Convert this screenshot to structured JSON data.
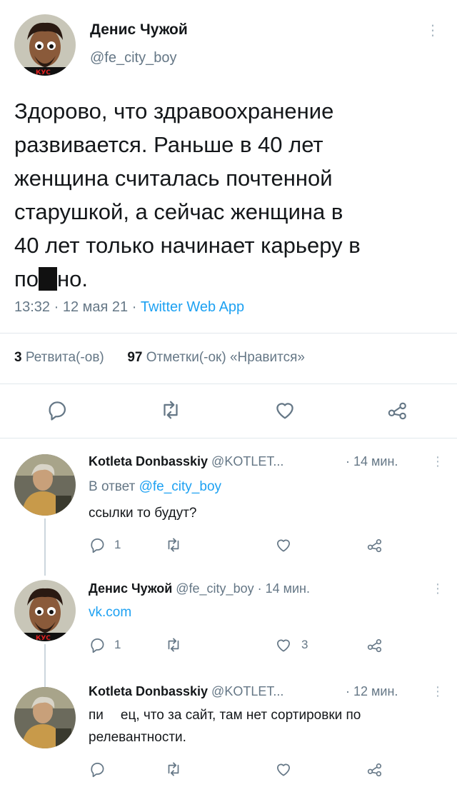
{
  "main_tweet": {
    "author_name": "Денис Чужой",
    "author_handle": "@fe_city_boy",
    "more_icon": "⋮",
    "text_lines": [
      "Здорово, что здравоохранение",
      "развивается. Раньше в 40 лет",
      "женщина считалась почтенной",
      "старушкой, а сейчас женщина в",
      "40 лет только начинает карьеру в"
    ],
    "last_line_start": "по",
    "last_line_end": "но.",
    "time": "13:32 · 12 мая 21 · ",
    "source": "Twitter Web App",
    "retweets_count": "3",
    "retweets_label": " Ретвита(-ов)",
    "likes_count": "97",
    "likes_label": " Отметки(-ок) «Нравится»"
  },
  "replies": [
    {
      "author_name": "Kotleta Donbasskiy",
      "author_handle": " @KOTLET...",
      "time": "· 14 мин.",
      "reply_to_prefix": "В ответ ",
      "reply_to_handle": "@fe_city_boy",
      "text": "ссылки то будут?",
      "reply_count": "1",
      "retweet_count": "",
      "like_count": ""
    },
    {
      "author_name": "Денис Чужой",
      "author_handle": " @fe_city_boy · 14 мин.",
      "link_text": "vk.com",
      "reply_count": "1",
      "retweet_count": "",
      "like_count": "3"
    },
    {
      "author_name": "Kotleta Donbasskiy",
      "author_handle": " @KOTLET...",
      "time": "· 12 мин.",
      "text_line1_a": "пи",
      "text_line1_b": "ец, что за сайт, там нет сортировки по",
      "text_line2": "релевантности.",
      "reply_count": "",
      "retweet_count": "",
      "like_count": ""
    }
  ],
  "colors": {
    "accent": "#1da1f2",
    "secondary_text": "#657786",
    "divider": "#e1e8ed"
  },
  "icons": [
    "reply-icon",
    "retweet-icon",
    "like-icon",
    "share-icon",
    "more-icon"
  ]
}
